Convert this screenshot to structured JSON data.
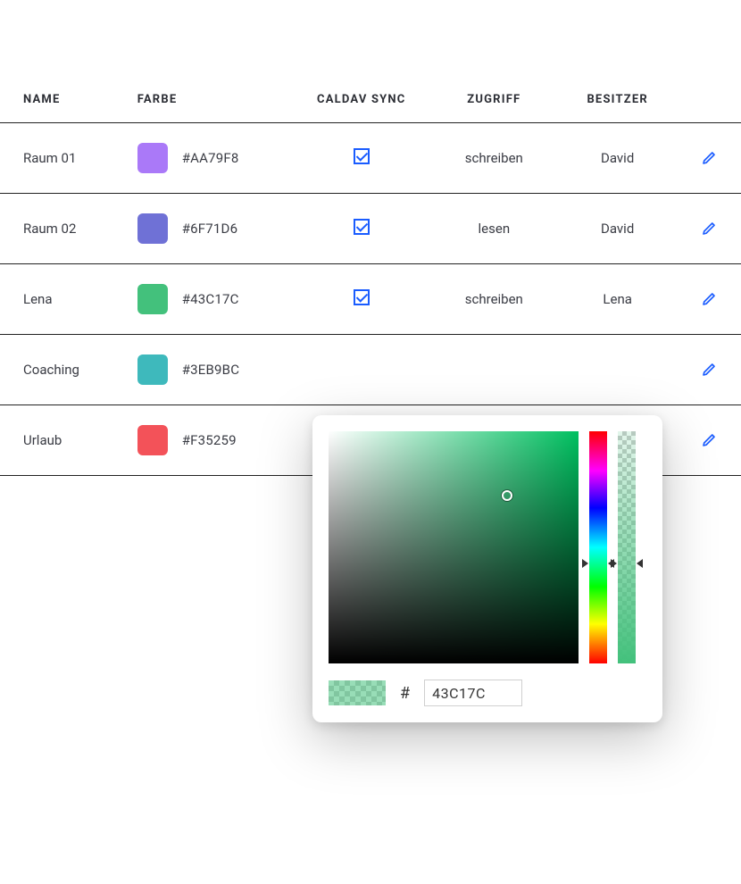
{
  "table": {
    "headers": {
      "name": "NAME",
      "color": "FARBE",
      "caldav": "CALDAV SYNC",
      "access": "ZUGRIFF",
      "owner": "BESITZER"
    },
    "rows": [
      {
        "name": "Raum 01",
        "hex": "#AA79F8",
        "swatch": "#AA79F8",
        "caldav_checked": true,
        "access": "schreiben",
        "owner": "David"
      },
      {
        "name": "Raum 02",
        "hex": "#6F71D6",
        "swatch": "#6F71D6",
        "caldav_checked": true,
        "access": "lesen",
        "owner": "David"
      },
      {
        "name": "Lena",
        "hex": "#43C17C",
        "swatch": "#43C17C",
        "caldav_checked": true,
        "access": "schreiben",
        "owner": "Lena"
      },
      {
        "name": "Coaching",
        "hex": "#3EB9BC",
        "swatch": "#3EB9BC",
        "caldav_checked": false,
        "access": "",
        "owner": ""
      },
      {
        "name": "Urlaub",
        "hex": "#F35259",
        "swatch": "#F35259",
        "caldav_checked": false,
        "access": "",
        "owner": ""
      }
    ]
  },
  "picker": {
    "hash_label": "#",
    "hex_value": "43C17C",
    "preview_color": "#43C17C"
  }
}
